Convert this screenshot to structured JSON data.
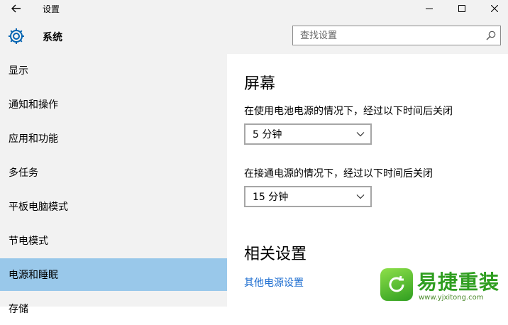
{
  "window": {
    "title": "设置"
  },
  "header": {
    "section_title": "系统",
    "search": {
      "placeholder": "查找设置",
      "value": ""
    }
  },
  "sidebar": {
    "items": [
      {
        "label": "显示",
        "active": false
      },
      {
        "label": "通知和操作",
        "active": false
      },
      {
        "label": "应用和功能",
        "active": false
      },
      {
        "label": "多任务",
        "active": false
      },
      {
        "label": "平板电脑模式",
        "active": false
      },
      {
        "label": "节电模式",
        "active": false
      },
      {
        "label": "电源和睡眠",
        "active": true
      },
      {
        "label": "存储",
        "active": false
      }
    ]
  },
  "main": {
    "screen_heading": "屏幕",
    "battery_label": "在使用电池电源的情况下，经过以下时间后关闭",
    "battery_value": "5 分钟",
    "plugged_label": "在接通电源的情况下，经过以下时间后关闭",
    "plugged_value": "15 分钟",
    "related_heading": "相关设置",
    "other_power_link": "其他电源设置"
  },
  "watermark": {
    "text": "易捷重装",
    "url": "www.yjxitong.com"
  },
  "colors": {
    "sidebar_bg": "#f2f2f2",
    "selected_bg": "#99c8ea",
    "link": "#1f6fd1",
    "accent": "#0063b1"
  }
}
